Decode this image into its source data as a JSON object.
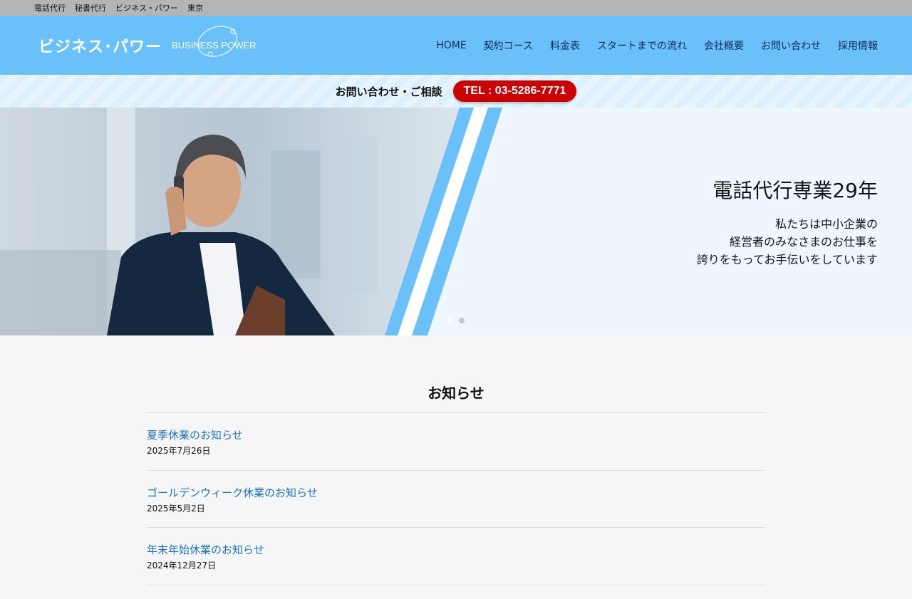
{
  "topbar": {
    "items": [
      "電話代行",
      "秘書代行",
      "ビジネス・パワー",
      "東京"
    ]
  },
  "header": {
    "logo_jp": "ビジネス･パワー",
    "logo_en": "BUSINESS POWER",
    "nav": [
      "HOME",
      "契約コース",
      "料金表",
      "スタートまでの流れ",
      "会社概要",
      "お問い合わせ",
      "採用情報"
    ]
  },
  "contact": {
    "label": "お問い合わせ・ご相談",
    "tel": "TEL : 03-5286-7771"
  },
  "hero": {
    "title": "電話代行専業29年",
    "lines": [
      "私たちは中小企業の",
      "経営者のみなさまのお仕事を",
      "誇りをもってお手伝いをしています"
    ]
  },
  "news": {
    "title": "お知らせ",
    "items": [
      {
        "title": "夏季休業のお知らせ",
        "date": "2025年7月26日"
      },
      {
        "title": "ゴールデンウィーク休業のお知らせ",
        "date": "2025年5月2日"
      },
      {
        "title": "年末年始休業のお知らせ",
        "date": "2024年12月27日"
      }
    ]
  },
  "colors": {
    "header": "#6ac1fa",
    "tel_button": "#cc0000",
    "link": "#1a73c9",
    "topbar": "#b5b5b5"
  }
}
